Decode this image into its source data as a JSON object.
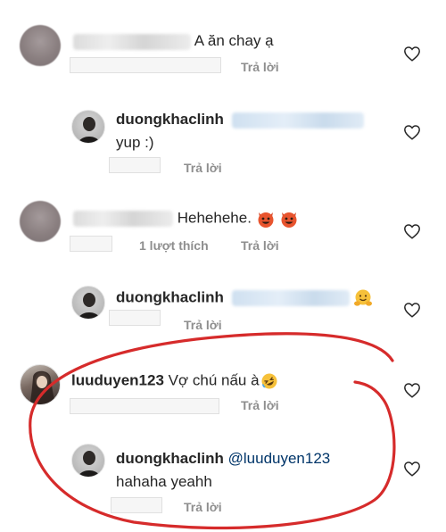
{
  "comments": [
    {
      "text": "A ăn chay ạ",
      "reply_label": "Trả lời"
    },
    {
      "username": "duongkhaclinh",
      "text": "yup :)",
      "reply_label": "Trả lời"
    },
    {
      "text": "Hehehehe.",
      "likes": "1 lượt thích",
      "reply_label": "Trả lời"
    },
    {
      "username": "duongkhaclinh",
      "reply_label": "Trả lời"
    },
    {
      "username": "luuduyen123",
      "text": "Vợ chú nấu à",
      "reply_label": "Trả lời"
    },
    {
      "username": "duongkhaclinh",
      "mention": "@luuduyen123",
      "text": "hahaha yeahh",
      "reply_label": "Trả lời"
    }
  ],
  "icons": {
    "like": "heart-outline-icon",
    "angry": "smiling-devil-emoji",
    "hug": "hugging-face-emoji",
    "laugh": "rolling-laughing-emoji"
  },
  "colors": {
    "annotation_circle": "#d62b2b",
    "mention": "#003569",
    "meta": "#8e8e8e"
  }
}
